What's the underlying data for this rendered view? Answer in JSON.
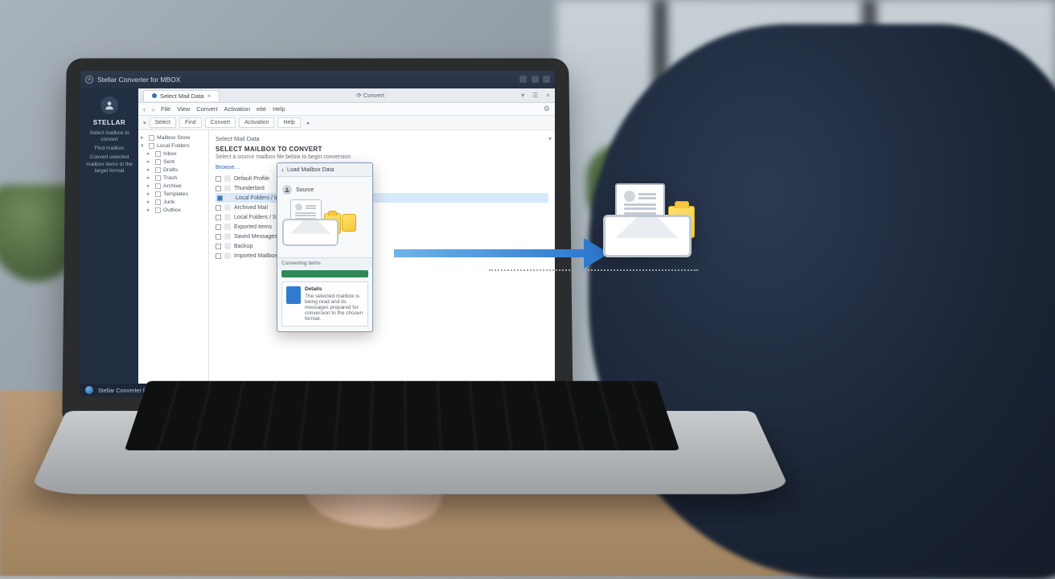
{
  "titlebar": {
    "title": "Stellar Converter for MBOX"
  },
  "sidebar": {
    "brand": "STELLAR",
    "lines": [
      "Select mailbox to convert",
      "Find mailbox",
      "Convert selected mailbox items to the target format"
    ]
  },
  "tab": {
    "label": "Select Mail Data",
    "center_label": "Convert"
  },
  "menubar": {
    "items": [
      "File",
      "View",
      "Convert",
      "Activation",
      "eite",
      "Help"
    ]
  },
  "ribbon": {
    "buttons": [
      "Select",
      "Find",
      "Convert",
      "Activation",
      "Help"
    ]
  },
  "tree": {
    "nodes": [
      "Mailbox Store",
      "Local Folders",
      "Inbox",
      "Sent",
      "Drafts",
      "Trash",
      "Archive",
      "Templates",
      "Junk",
      "Outbox"
    ]
  },
  "pane": {
    "crumb": "Select Mail Data",
    "heading": "SELECT MAILBOX TO CONVERT",
    "sub": "Select a source mailbox file below to begin conversion",
    "link": "Browse…",
    "rows": [
      "Default Profile",
      "Thunderbird",
      "Local Folders / Inbox",
      "Archived Mail",
      "Local Folders / Sent",
      "Exported Items",
      "Saved Messages",
      "Backup",
      "Imported Mailbox"
    ],
    "selected_index": 2
  },
  "dialog": {
    "title": "Load Mailbox Data",
    "source_label": "Source",
    "progress_label": "Converting items",
    "progress_pct": 100,
    "info_title": "Details",
    "info_body": "The selected mailbox is being read and its messages prepared for conversion to the chosen format."
  },
  "taskbar": {
    "text": "Stellar Converter for MBOX"
  }
}
